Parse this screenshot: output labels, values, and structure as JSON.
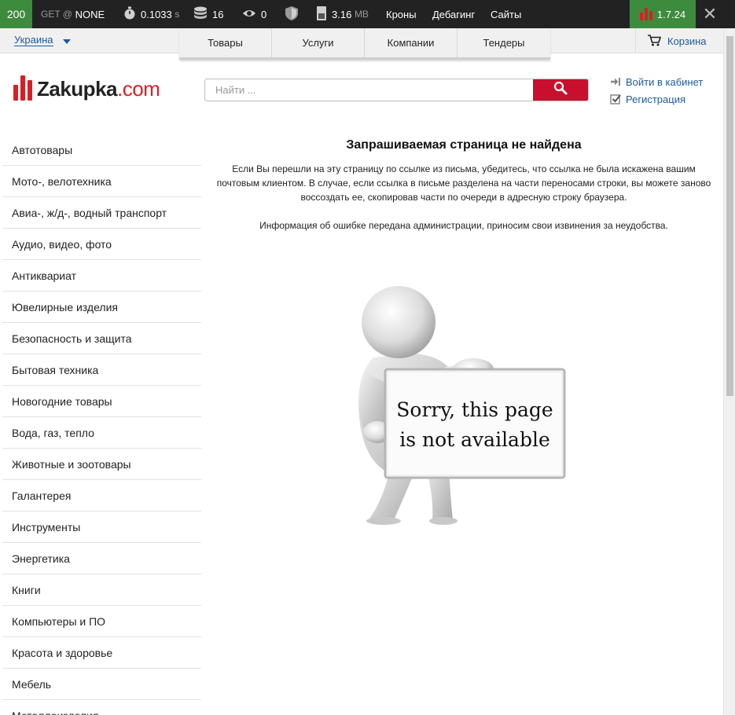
{
  "debug": {
    "status": "200",
    "request_method": "GET @",
    "request_target": "NONE",
    "time_value": "0.1033",
    "time_unit": "s",
    "queries": "16",
    "calls": "0",
    "memory_value": "3.16",
    "memory_unit": "MB",
    "links": [
      "Кроны",
      "Дебагинг",
      "Сайты"
    ],
    "version": "1.7.24",
    "close": "✕"
  },
  "topbar": {
    "region": "Украина",
    "tabs": [
      "Товары",
      "Услуги",
      "Компании",
      "Тендеры"
    ],
    "cart": "Корзина"
  },
  "header": {
    "logo_word": "Zakupka",
    "logo_domain": ".com",
    "search_placeholder": "Найти ...",
    "login": "Войти в кабинет",
    "register": "Регистрация"
  },
  "sidebar": {
    "categories": [
      "Автотовары",
      "Мото-, велотехника",
      "Авиа-, ж/д-, водный транспорт",
      "Аудио, видео, фото",
      "Антиквариат",
      "Ювелирные изделия",
      "Безопасность и защита",
      "Бытовая техника",
      "Новогодние товары",
      "Вода, газ, тепло",
      "Животные и зоотовары",
      "Галантерея",
      "Инструменты",
      "Энергетика",
      "Книги",
      "Компьютеры и ПО",
      "Красота и здоровье",
      "Мебель",
      "Металлоизделия"
    ]
  },
  "main": {
    "title": "Запрашиваемая страница не найдена",
    "paragraph1": "Если Вы перешли на эту страницу по ссылке из письма, убедитесь, что ссылка не была искажена вашим почтовым клиентом. В случае, если ссылка в письме разделена на части переносами строки, вы можете заново воссоздать ее, скопировав части по очереди в адресную строку браузера.",
    "paragraph2": "Информация об ошибке передана администрации, приносим свои извинения за неудобства.",
    "sign_line1": "Sorry, this page",
    "sign_line2": "is not available"
  },
  "colors": {
    "brand_red": "#d81f26",
    "debug_green": "#3d8b3d",
    "link_blue": "#1d5b9d"
  }
}
